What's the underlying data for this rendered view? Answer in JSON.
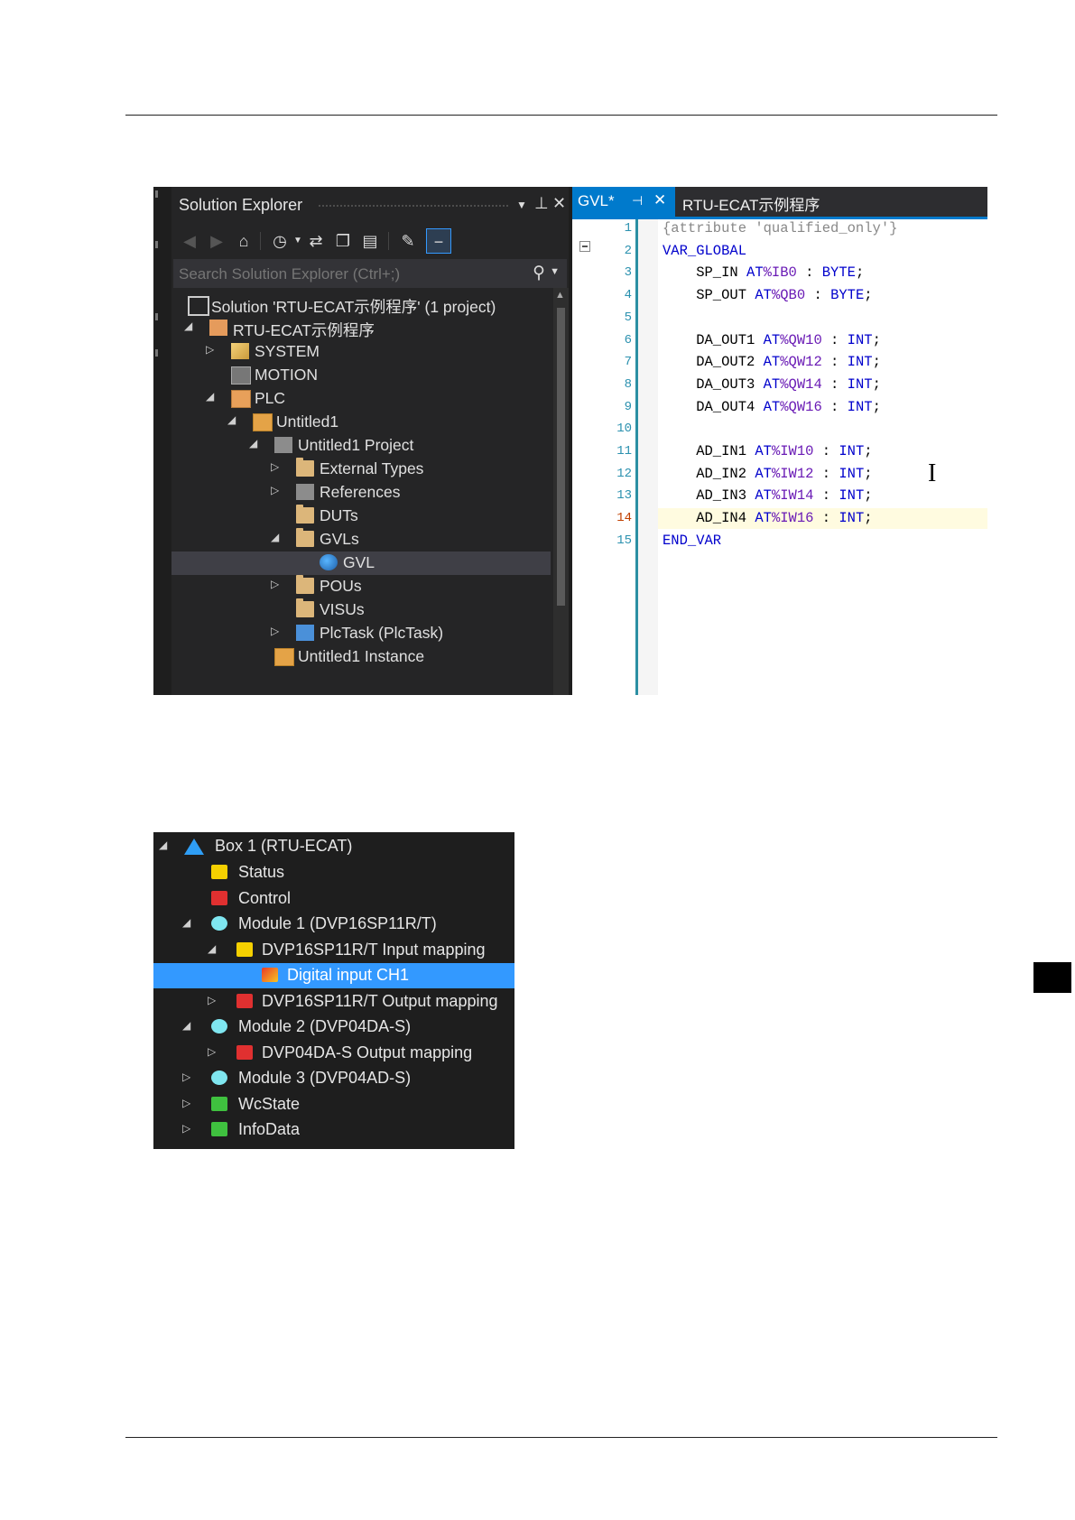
{
  "solution_explorer": {
    "title": "Solution Explorer",
    "search_placeholder": "Search Solution Explorer (Ctrl+;)",
    "tree": [
      {
        "label": "Solution 'RTU-ECAT示例程序' (1 project)",
        "icon": "solution-icon"
      },
      {
        "label": "RTU-ECAT示例程序",
        "icon": "project-icon",
        "expanded": true
      },
      {
        "label": "SYSTEM",
        "icon": "system-icon",
        "expanded": false
      },
      {
        "label": "MOTION",
        "icon": "motion-icon"
      },
      {
        "label": "PLC",
        "icon": "plc-icon",
        "expanded": true
      },
      {
        "label": "Untitled1",
        "icon": "device-icon",
        "expanded": true
      },
      {
        "label": "Untitled1 Project",
        "icon": "plc-project-icon",
        "expanded": true
      },
      {
        "label": "External Types",
        "icon": "folder-icon",
        "expanded": false
      },
      {
        "label": "References",
        "icon": "references-icon",
        "expanded": false
      },
      {
        "label": "DUTs",
        "icon": "folder-icon"
      },
      {
        "label": "GVLs",
        "icon": "folder-open-icon",
        "expanded": true
      },
      {
        "label": "GVL",
        "icon": "gvl-icon",
        "selected": true
      },
      {
        "label": "POUs",
        "icon": "folder-icon",
        "expanded": false
      },
      {
        "label": "VISUs",
        "icon": "folder-icon"
      },
      {
        "label": "PlcTask (PlcTask)",
        "icon": "task-icon",
        "expanded": false
      },
      {
        "label": "Untitled1 Instance",
        "icon": "instance-icon"
      }
    ]
  },
  "editor": {
    "active_tab": "GVL*",
    "other_tab": "RTU-ECAT示例程序",
    "current_line": 14,
    "lines": [
      {
        "n": "1",
        "text": "{attribute 'qualified_only'}"
      },
      {
        "n": "2",
        "text": "VAR_GLOBAL"
      },
      {
        "n": "3",
        "text": "    SP_IN AT%IB0 : BYTE;"
      },
      {
        "n": "4",
        "text": "    SP_OUT AT%QB0 : BYTE;"
      },
      {
        "n": "5",
        "text": ""
      },
      {
        "n": "6",
        "text": "    DA_OUT1 AT%QW10 : INT;"
      },
      {
        "n": "7",
        "text": "    DA_OUT2 AT%QW12 : INT;"
      },
      {
        "n": "8",
        "text": "    DA_OUT3 AT%QW14 : INT;"
      },
      {
        "n": "9",
        "text": "    DA_OUT4 AT%QW16 : INT;"
      },
      {
        "n": "10",
        "text": ""
      },
      {
        "n": "11",
        "text": "    AD_IN1 AT%IW10 : INT;"
      },
      {
        "n": "12",
        "text": "    AD_IN2 AT%IW12 : INT;"
      },
      {
        "n": "13",
        "text": "    AD_IN3 AT%IW14 : INT;"
      },
      {
        "n": "14",
        "text": "    AD_IN4 AT%IW16 : INT;"
      },
      {
        "n": "15",
        "text": "END_VAR"
      }
    ]
  },
  "io_tree": [
    {
      "label": "Box 1 (RTU-ECAT)",
      "icon": "box-icon",
      "expanded": true
    },
    {
      "label": "Status",
      "icon": "status-icon"
    },
    {
      "label": "Control",
      "icon": "control-icon"
    },
    {
      "label": "Module 1 (DVP16SP11R/T)",
      "icon": "module-icon",
      "expanded": true
    },
    {
      "label": "DVP16SP11R/T Input mapping",
      "icon": "input-mapping-icon",
      "expanded": true
    },
    {
      "label": "Digital input CH1",
      "icon": "digital-input-icon",
      "selected": true
    },
    {
      "label": "DVP16SP11R/T Output mapping",
      "icon": "output-mapping-icon",
      "expanded": false
    },
    {
      "label": "Module 2 (DVP04DA-S)",
      "icon": "module-icon",
      "expanded": true
    },
    {
      "label": "DVP04DA-S Output mapping",
      "icon": "output-mapping-icon",
      "expanded": false
    },
    {
      "label": "Module 3 (DVP04AD-S)",
      "icon": "module-icon",
      "expanded": false
    },
    {
      "label": "WcState",
      "icon": "wcstate-icon",
      "expanded": false
    },
    {
      "label": "InfoData",
      "icon": "infodata-icon",
      "expanded": false
    }
  ],
  "colors": {
    "accent": "#007acc",
    "selection_blue": "#3399ff",
    "dark_bg": "#1e1e1e",
    "panel_bg": "#252526"
  }
}
